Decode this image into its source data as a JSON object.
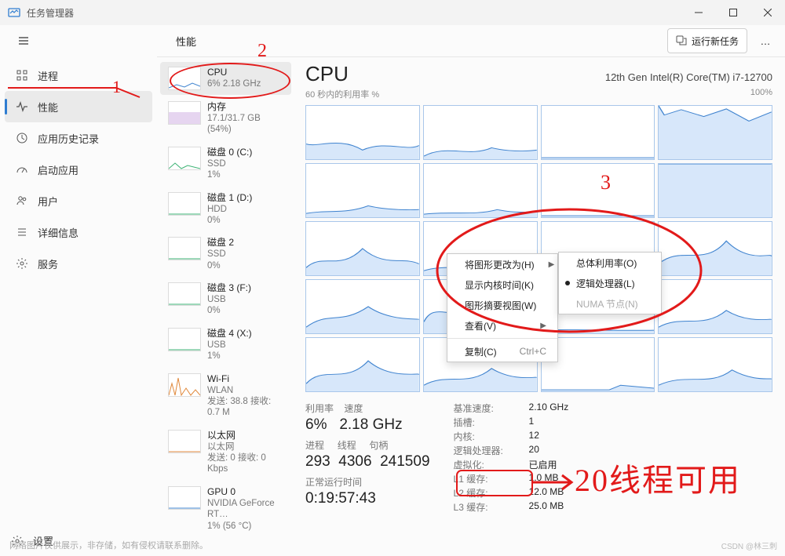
{
  "window": {
    "title": "任务管理器"
  },
  "header": {
    "tab": "性能",
    "new_task": "运行新任务"
  },
  "nav": {
    "items": [
      {
        "icon": "processes",
        "label": "进程"
      },
      {
        "icon": "performance",
        "label": "性能"
      },
      {
        "icon": "history",
        "label": "应用历史记录"
      },
      {
        "icon": "startup",
        "label": "启动应用"
      },
      {
        "icon": "users",
        "label": "用户"
      },
      {
        "icon": "details",
        "label": "详细信息"
      },
      {
        "icon": "services",
        "label": "服务"
      }
    ],
    "settings": "设置"
  },
  "perf_list": [
    {
      "title": "CPU",
      "sub": "6% 2.18 GHz"
    },
    {
      "title": "内存",
      "sub": "17.1/31.7 GB (54%)"
    },
    {
      "title": "磁盘 0 (C:)",
      "sub": "SSD",
      "sub2": "1%"
    },
    {
      "title": "磁盘 1 (D:)",
      "sub": "HDD",
      "sub2": "0%"
    },
    {
      "title": "磁盘 2",
      "sub": "SSD",
      "sub2": "0%"
    },
    {
      "title": "磁盘 3 (F:)",
      "sub": "USB",
      "sub2": "0%"
    },
    {
      "title": "磁盘 4 (X:)",
      "sub": "USB",
      "sub2": "1%"
    },
    {
      "title": "Wi-Fi",
      "sub": "WLAN",
      "sub2": "发送: 38.8 接收: 0.7 M"
    },
    {
      "title": "以太网",
      "sub": "以太网",
      "sub2": "发送: 0 接收: 0 Kbps"
    },
    {
      "title": "GPU 0",
      "sub": "NVIDIA GeForce RT…",
      "sub2": "1% (56 °C)"
    }
  ],
  "detail": {
    "title": "CPU",
    "cpu_name": "12th Gen Intel(R) Core(TM) i7-12700",
    "subleft": "60 秒内的利用率 %",
    "subright": "100%",
    "stats_left_labels": {
      "util": "利用率",
      "speed": "速度"
    },
    "stats_left_values": {
      "util": "6%",
      "speed": "2.18 GHz"
    },
    "stats_row2_labels": {
      "proc": "进程",
      "threads": "线程",
      "handles": "句柄"
    },
    "stats_row2_values": {
      "proc": "293",
      "threads": "4306",
      "handles": "241509"
    },
    "uptime_label": "正常运行时间",
    "uptime": "0:19:57:43",
    "kv": [
      {
        "k": "基准速度:",
        "v": "2.10 GHz"
      },
      {
        "k": "插槽:",
        "v": "1"
      },
      {
        "k": "内核:",
        "v": "12"
      },
      {
        "k": "逻辑处理器:",
        "v": "20"
      },
      {
        "k": "虚拟化:",
        "v": "已启用"
      },
      {
        "k": "L1 缓存:",
        "v": "1.0 MB"
      },
      {
        "k": "L2 缓存:",
        "v": "12.0 MB"
      },
      {
        "k": "L3 缓存:",
        "v": "25.0 MB"
      }
    ]
  },
  "context_menu": {
    "items": [
      {
        "label": "将图形更改为(H)",
        "arrow": true
      },
      {
        "label": "显示内核时间(K)"
      },
      {
        "label": "图形摘要视图(W)"
      },
      {
        "label": "查看(V)",
        "arrow": true
      },
      {
        "label": "复制(C)",
        "shortcut": "Ctrl+C",
        "sep_above": true
      }
    ]
  },
  "submenu": {
    "items": [
      {
        "label": "总体利用率(O)"
      },
      {
        "label": "逻辑处理器(L)",
        "selected": true
      },
      {
        "label": "NUMA 节点(N)",
        "disabled": true
      }
    ]
  },
  "annotations": {
    "n1": "1",
    "n2": "2",
    "n3": "3",
    "arrow_txt": "20线程可用"
  },
  "footer": "网络图片仅供展示，非存储，如有侵权请联系删除。",
  "watermark": "CSDN @林三刺"
}
